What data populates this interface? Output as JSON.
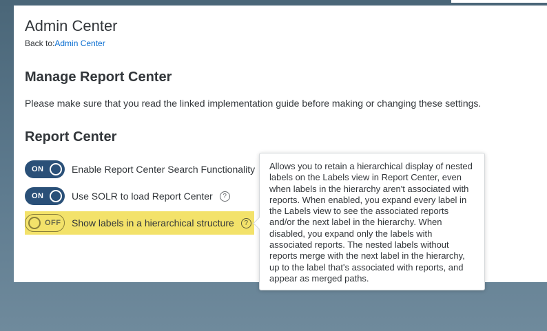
{
  "header": {
    "app_title": "Admin Center",
    "back_prefix": "Back to:",
    "back_link": "Admin Center"
  },
  "manage": {
    "heading": "Manage Report Center",
    "intro": "Please make sure that you read the linked implementation guide before making or changing these settings."
  },
  "report_center": {
    "heading": "Report Center",
    "settings": [
      {
        "label": "Enable Report Center Search Functionality",
        "state": "ON"
      },
      {
        "label": "Use SOLR to load Report Center",
        "state": "ON"
      },
      {
        "label": "Show labels in a hierarchical structure",
        "state": "OFF"
      }
    ]
  },
  "tooltip": {
    "text": "Allows you to retain a hierarchical display of nested labels on the Labels view in Report Center, even when labels in the hierarchy aren't associated with reports. When enabled, you expand every label in the Labels view to see the associated reports and/or the next label in the hierarchy. When disabled, you expand only the labels with associated reports. The nested labels without reports merge with the next label in the hierarchy, up to the label that's associated with reports, and appear as merged paths."
  },
  "icons": {
    "help": "question-circle-icon"
  },
  "colors": {
    "toggle_on": "#2a5078",
    "highlight": "#f3e26a",
    "link": "#0a6ed1"
  }
}
